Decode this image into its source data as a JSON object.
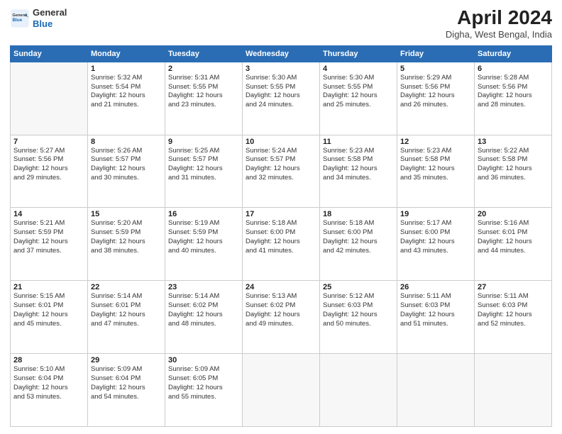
{
  "header": {
    "logo_line1": "General",
    "logo_line2": "Blue",
    "month_title": "April 2024",
    "location": "Digha, West Bengal, India"
  },
  "weekdays": [
    "Sunday",
    "Monday",
    "Tuesday",
    "Wednesday",
    "Thursday",
    "Friday",
    "Saturday"
  ],
  "weeks": [
    [
      {
        "day": "",
        "sunrise": "",
        "sunset": "",
        "daylight": ""
      },
      {
        "day": "1",
        "sunrise": "5:32 AM",
        "sunset": "5:54 PM",
        "daylight": "12 hours and 21 minutes."
      },
      {
        "day": "2",
        "sunrise": "5:31 AM",
        "sunset": "5:55 PM",
        "daylight": "12 hours and 23 minutes."
      },
      {
        "day": "3",
        "sunrise": "5:30 AM",
        "sunset": "5:55 PM",
        "daylight": "12 hours and 24 minutes."
      },
      {
        "day": "4",
        "sunrise": "5:30 AM",
        "sunset": "5:55 PM",
        "daylight": "12 hours and 25 minutes."
      },
      {
        "day": "5",
        "sunrise": "5:29 AM",
        "sunset": "5:56 PM",
        "daylight": "12 hours and 26 minutes."
      },
      {
        "day": "6",
        "sunrise": "5:28 AM",
        "sunset": "5:56 PM",
        "daylight": "12 hours and 28 minutes."
      }
    ],
    [
      {
        "day": "7",
        "sunrise": "5:27 AM",
        "sunset": "5:56 PM",
        "daylight": "12 hours and 29 minutes."
      },
      {
        "day": "8",
        "sunrise": "5:26 AM",
        "sunset": "5:57 PM",
        "daylight": "12 hours and 30 minutes."
      },
      {
        "day": "9",
        "sunrise": "5:25 AM",
        "sunset": "5:57 PM",
        "daylight": "12 hours and 31 minutes."
      },
      {
        "day": "10",
        "sunrise": "5:24 AM",
        "sunset": "5:57 PM",
        "daylight": "12 hours and 32 minutes."
      },
      {
        "day": "11",
        "sunrise": "5:23 AM",
        "sunset": "5:58 PM",
        "daylight": "12 hours and 34 minutes."
      },
      {
        "day": "12",
        "sunrise": "5:23 AM",
        "sunset": "5:58 PM",
        "daylight": "12 hours and 35 minutes."
      },
      {
        "day": "13",
        "sunrise": "5:22 AM",
        "sunset": "5:58 PM",
        "daylight": "12 hours and 36 minutes."
      }
    ],
    [
      {
        "day": "14",
        "sunrise": "5:21 AM",
        "sunset": "5:59 PM",
        "daylight": "12 hours and 37 minutes."
      },
      {
        "day": "15",
        "sunrise": "5:20 AM",
        "sunset": "5:59 PM",
        "daylight": "12 hours and 38 minutes."
      },
      {
        "day": "16",
        "sunrise": "5:19 AM",
        "sunset": "5:59 PM",
        "daylight": "12 hours and 40 minutes."
      },
      {
        "day": "17",
        "sunrise": "5:18 AM",
        "sunset": "6:00 PM",
        "daylight": "12 hours and 41 minutes."
      },
      {
        "day": "18",
        "sunrise": "5:18 AM",
        "sunset": "6:00 PM",
        "daylight": "12 hours and 42 minutes."
      },
      {
        "day": "19",
        "sunrise": "5:17 AM",
        "sunset": "6:00 PM",
        "daylight": "12 hours and 43 minutes."
      },
      {
        "day": "20",
        "sunrise": "5:16 AM",
        "sunset": "6:01 PM",
        "daylight": "12 hours and 44 minutes."
      }
    ],
    [
      {
        "day": "21",
        "sunrise": "5:15 AM",
        "sunset": "6:01 PM",
        "daylight": "12 hours and 45 minutes."
      },
      {
        "day": "22",
        "sunrise": "5:14 AM",
        "sunset": "6:01 PM",
        "daylight": "12 hours and 47 minutes."
      },
      {
        "day": "23",
        "sunrise": "5:14 AM",
        "sunset": "6:02 PM",
        "daylight": "12 hours and 48 minutes."
      },
      {
        "day": "24",
        "sunrise": "5:13 AM",
        "sunset": "6:02 PM",
        "daylight": "12 hours and 49 minutes."
      },
      {
        "day": "25",
        "sunrise": "5:12 AM",
        "sunset": "6:03 PM",
        "daylight": "12 hours and 50 minutes."
      },
      {
        "day": "26",
        "sunrise": "5:11 AM",
        "sunset": "6:03 PM",
        "daylight": "12 hours and 51 minutes."
      },
      {
        "day": "27",
        "sunrise": "5:11 AM",
        "sunset": "6:03 PM",
        "daylight": "12 hours and 52 minutes."
      }
    ],
    [
      {
        "day": "28",
        "sunrise": "5:10 AM",
        "sunset": "6:04 PM",
        "daylight": "12 hours and 53 minutes."
      },
      {
        "day": "29",
        "sunrise": "5:09 AM",
        "sunset": "6:04 PM",
        "daylight": "12 hours and 54 minutes."
      },
      {
        "day": "30",
        "sunrise": "5:09 AM",
        "sunset": "6:05 PM",
        "daylight": "12 hours and 55 minutes."
      },
      {
        "day": "",
        "sunrise": "",
        "sunset": "",
        "daylight": ""
      },
      {
        "day": "",
        "sunrise": "",
        "sunset": "",
        "daylight": ""
      },
      {
        "day": "",
        "sunrise": "",
        "sunset": "",
        "daylight": ""
      },
      {
        "day": "",
        "sunrise": "",
        "sunset": "",
        "daylight": ""
      }
    ]
  ]
}
